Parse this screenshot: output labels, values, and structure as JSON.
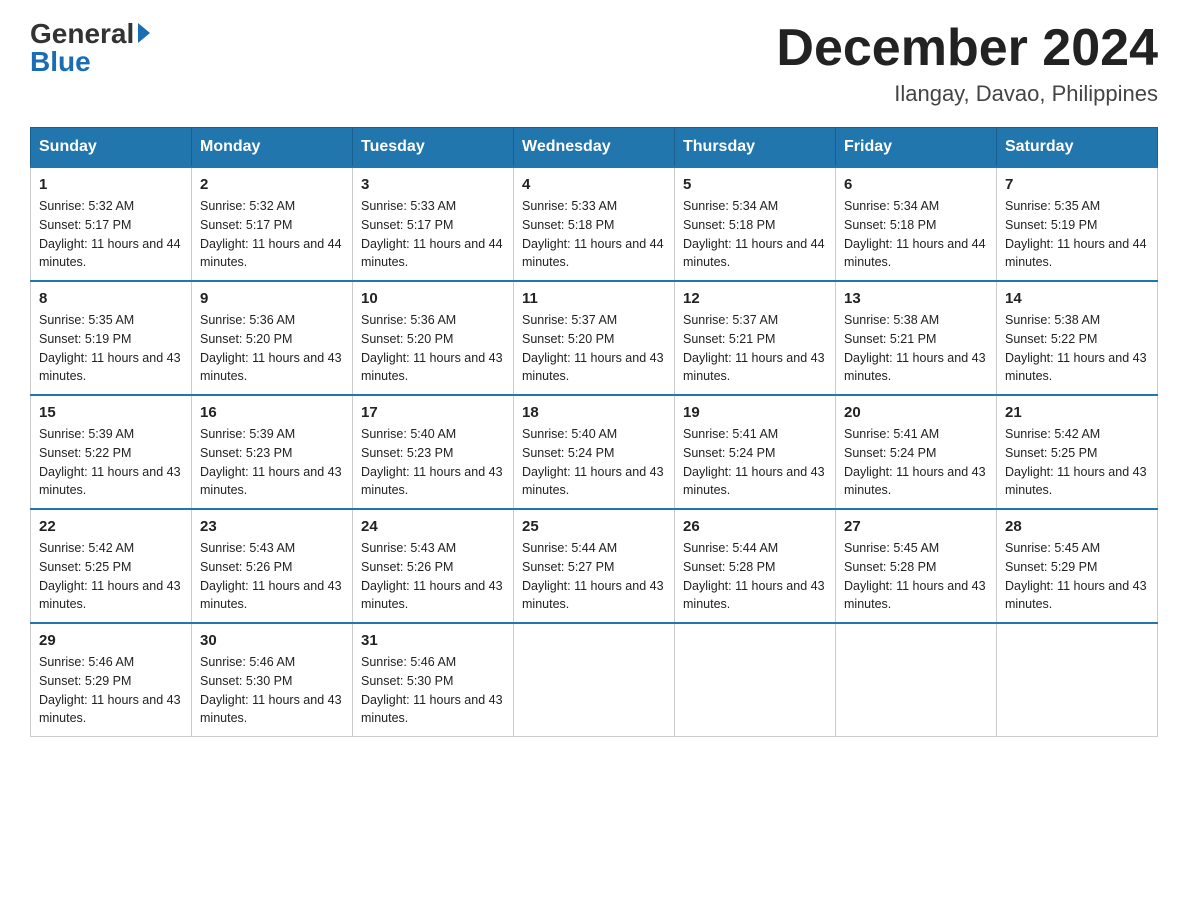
{
  "header": {
    "logo_general": "General",
    "logo_blue": "Blue",
    "month_year": "December 2024",
    "location": "Ilangay, Davao, Philippines"
  },
  "weekdays": [
    "Sunday",
    "Monday",
    "Tuesday",
    "Wednesday",
    "Thursday",
    "Friday",
    "Saturday"
  ],
  "weeks": [
    [
      {
        "day": "1",
        "sunrise": "5:32 AM",
        "sunset": "5:17 PM",
        "daylight": "11 hours and 44 minutes."
      },
      {
        "day": "2",
        "sunrise": "5:32 AM",
        "sunset": "5:17 PM",
        "daylight": "11 hours and 44 minutes."
      },
      {
        "day": "3",
        "sunrise": "5:33 AM",
        "sunset": "5:17 PM",
        "daylight": "11 hours and 44 minutes."
      },
      {
        "day": "4",
        "sunrise": "5:33 AM",
        "sunset": "5:18 PM",
        "daylight": "11 hours and 44 minutes."
      },
      {
        "day": "5",
        "sunrise": "5:34 AM",
        "sunset": "5:18 PM",
        "daylight": "11 hours and 44 minutes."
      },
      {
        "day": "6",
        "sunrise": "5:34 AM",
        "sunset": "5:18 PM",
        "daylight": "11 hours and 44 minutes."
      },
      {
        "day": "7",
        "sunrise": "5:35 AM",
        "sunset": "5:19 PM",
        "daylight": "11 hours and 44 minutes."
      }
    ],
    [
      {
        "day": "8",
        "sunrise": "5:35 AM",
        "sunset": "5:19 PM",
        "daylight": "11 hours and 43 minutes."
      },
      {
        "day": "9",
        "sunrise": "5:36 AM",
        "sunset": "5:20 PM",
        "daylight": "11 hours and 43 minutes."
      },
      {
        "day": "10",
        "sunrise": "5:36 AM",
        "sunset": "5:20 PM",
        "daylight": "11 hours and 43 minutes."
      },
      {
        "day": "11",
        "sunrise": "5:37 AM",
        "sunset": "5:20 PM",
        "daylight": "11 hours and 43 minutes."
      },
      {
        "day": "12",
        "sunrise": "5:37 AM",
        "sunset": "5:21 PM",
        "daylight": "11 hours and 43 minutes."
      },
      {
        "day": "13",
        "sunrise": "5:38 AM",
        "sunset": "5:21 PM",
        "daylight": "11 hours and 43 minutes."
      },
      {
        "day": "14",
        "sunrise": "5:38 AM",
        "sunset": "5:22 PM",
        "daylight": "11 hours and 43 minutes."
      }
    ],
    [
      {
        "day": "15",
        "sunrise": "5:39 AM",
        "sunset": "5:22 PM",
        "daylight": "11 hours and 43 minutes."
      },
      {
        "day": "16",
        "sunrise": "5:39 AM",
        "sunset": "5:23 PM",
        "daylight": "11 hours and 43 minutes."
      },
      {
        "day": "17",
        "sunrise": "5:40 AM",
        "sunset": "5:23 PM",
        "daylight": "11 hours and 43 minutes."
      },
      {
        "day": "18",
        "sunrise": "5:40 AM",
        "sunset": "5:24 PM",
        "daylight": "11 hours and 43 minutes."
      },
      {
        "day": "19",
        "sunrise": "5:41 AM",
        "sunset": "5:24 PM",
        "daylight": "11 hours and 43 minutes."
      },
      {
        "day": "20",
        "sunrise": "5:41 AM",
        "sunset": "5:24 PM",
        "daylight": "11 hours and 43 minutes."
      },
      {
        "day": "21",
        "sunrise": "5:42 AM",
        "sunset": "5:25 PM",
        "daylight": "11 hours and 43 minutes."
      }
    ],
    [
      {
        "day": "22",
        "sunrise": "5:42 AM",
        "sunset": "5:25 PM",
        "daylight": "11 hours and 43 minutes."
      },
      {
        "day": "23",
        "sunrise": "5:43 AM",
        "sunset": "5:26 PM",
        "daylight": "11 hours and 43 minutes."
      },
      {
        "day": "24",
        "sunrise": "5:43 AM",
        "sunset": "5:26 PM",
        "daylight": "11 hours and 43 minutes."
      },
      {
        "day": "25",
        "sunrise": "5:44 AM",
        "sunset": "5:27 PM",
        "daylight": "11 hours and 43 minutes."
      },
      {
        "day": "26",
        "sunrise": "5:44 AM",
        "sunset": "5:28 PM",
        "daylight": "11 hours and 43 minutes."
      },
      {
        "day": "27",
        "sunrise": "5:45 AM",
        "sunset": "5:28 PM",
        "daylight": "11 hours and 43 minutes."
      },
      {
        "day": "28",
        "sunrise": "5:45 AM",
        "sunset": "5:29 PM",
        "daylight": "11 hours and 43 minutes."
      }
    ],
    [
      {
        "day": "29",
        "sunrise": "5:46 AM",
        "sunset": "5:29 PM",
        "daylight": "11 hours and 43 minutes."
      },
      {
        "day": "30",
        "sunrise": "5:46 AM",
        "sunset": "5:30 PM",
        "daylight": "11 hours and 43 minutes."
      },
      {
        "day": "31",
        "sunrise": "5:46 AM",
        "sunset": "5:30 PM",
        "daylight": "11 hours and 43 minutes."
      },
      null,
      null,
      null,
      null
    ]
  ]
}
